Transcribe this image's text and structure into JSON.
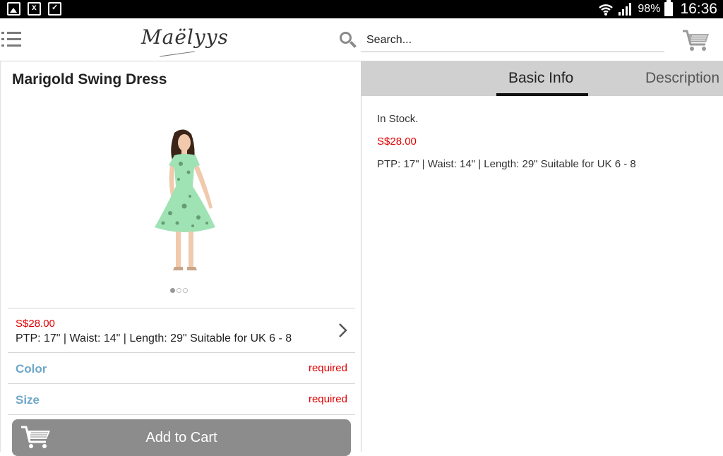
{
  "status_bar": {
    "icons": [
      "gallery-icon",
      "spreadsheet-icon",
      "clipboard-check-icon",
      "wifi-icon",
      "signal-icon"
    ],
    "battery": "98%",
    "time": "16:36"
  },
  "toolbar": {
    "logo_text": "Maëlyys",
    "search_placeholder": "Search...",
    "search_value": ""
  },
  "product": {
    "title": "Marigold Swing Dress",
    "price": "S$28.00",
    "measurements": "PTP: 17\" | Waist: 14\" | Length: 29\" Suitable for UK 6 - 8",
    "image_count": 3,
    "active_image": 1,
    "options": [
      {
        "label": "Color",
        "status": "required"
      },
      {
        "label": "Size",
        "status": "required"
      }
    ],
    "add_to_cart_label": "Add to Cart"
  },
  "details": {
    "tabs": [
      {
        "label": "Basic Info",
        "active": true
      },
      {
        "label": "Description",
        "active": false
      }
    ],
    "stock": "In Stock.",
    "price": "S$28.00",
    "measurements": "PTP: 17\" | Waist: 14\" | Length: 29\" Suitable for UK 6 - 8"
  },
  "colors": {
    "price_red": "#e00000",
    "option_blue": "#6fa7c9",
    "tabbar_gray": "#d0d0d0",
    "button_gray": "#8c8c8c",
    "dress_green": "#9fe3b5"
  }
}
